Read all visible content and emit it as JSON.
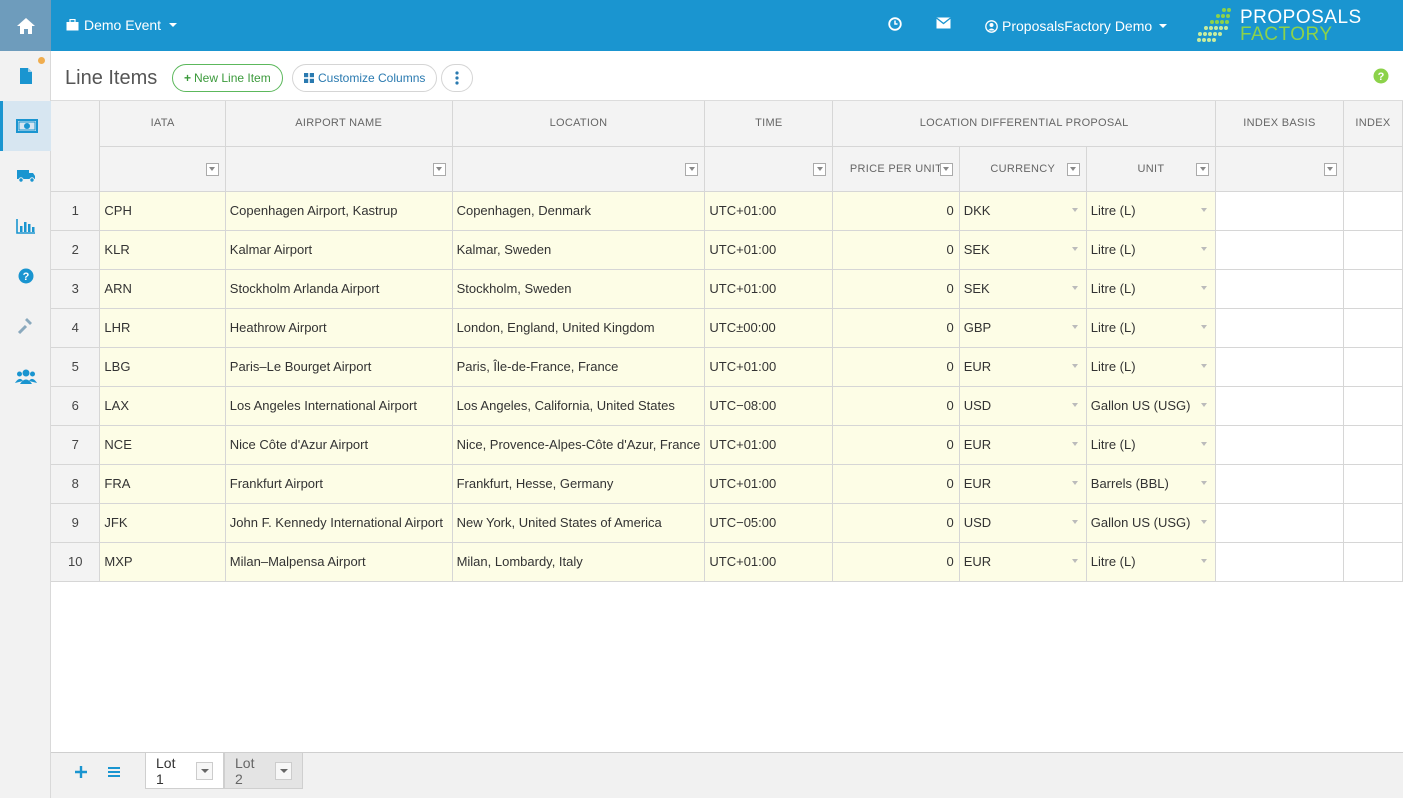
{
  "colors": {
    "accent": "#1a95d0",
    "logo_green": "#8cd24a",
    "row_highlight": "#fdfde6",
    "new_button": "#3c9a3c"
  },
  "rail": {
    "items": [
      {
        "icon": "document-icon",
        "active": false,
        "badge": true
      },
      {
        "icon": "money-icon",
        "active": true
      },
      {
        "icon": "truck-icon",
        "active": false
      },
      {
        "icon": "chart-icon",
        "active": false
      },
      {
        "icon": "question-icon",
        "active": false
      },
      {
        "icon": "wrench-icon",
        "active": false
      },
      {
        "icon": "users-icon",
        "active": false
      }
    ]
  },
  "topbar": {
    "event_label": "Demo Event",
    "user_label": "ProposalsFactory Demo",
    "logo_line1": "PROPOSALS",
    "logo_line2": "FACTORY"
  },
  "toolbar": {
    "title": "Line Items",
    "new_label": "New Line Item",
    "customize_label": "Customize Columns"
  },
  "grid": {
    "headers": {
      "iata": "IATA",
      "airport": "AIRPORT NAME",
      "location": "LOCATION",
      "time": "TIME",
      "group": "LOCATION DIFFERENTIAL PROPOSAL",
      "index_basis": "INDEX BASIS",
      "index": "INDEX"
    },
    "subheaders": {
      "price": "PRICE PER UNIT",
      "currency": "CURRENCY",
      "unit": "UNIT"
    },
    "rows": [
      {
        "n": "1",
        "iata": "CPH",
        "airport": "Copenhagen Airport, Kastrup",
        "location": "Copenhagen, Denmark",
        "time": "UTC+01:00",
        "price": "0",
        "currency": "DKK",
        "unit": "Litre (L)"
      },
      {
        "n": "2",
        "iata": "KLR",
        "airport": "Kalmar Airport",
        "location": "Kalmar, Sweden",
        "time": "UTC+01:00",
        "price": "0",
        "currency": "SEK",
        "unit": "Litre (L)"
      },
      {
        "n": "3",
        "iata": "ARN",
        "airport": "Stockholm Arlanda Airport",
        "location": "Stockholm, Sweden",
        "time": "UTC+01:00",
        "price": "0",
        "currency": "SEK",
        "unit": "Litre (L)"
      },
      {
        "n": "4",
        "iata": "LHR",
        "airport": "Heathrow Airport",
        "location": "London, England, United Kingdom",
        "time": "UTC±00:00",
        "price": "0",
        "currency": "GBP",
        "unit": "Litre (L)"
      },
      {
        "n": "5",
        "iata": "LBG",
        "airport": "Paris–Le Bourget Airport",
        "location": "Paris, Île-de-France, France",
        "time": "UTC+01:00",
        "price": "0",
        "currency": "EUR",
        "unit": "Litre (L)"
      },
      {
        "n": "6",
        "iata": "LAX",
        "airport": "Los Angeles International Airport",
        "location": "Los Angeles, California, United States",
        "time": "UTC−08:00",
        "price": "0",
        "currency": "USD",
        "unit": "Gallon US (USG)"
      },
      {
        "n": "7",
        "iata": "NCE",
        "airport": "Nice Côte d'Azur Airport",
        "location": "Nice, Provence-Alpes-Côte d'Azur, France",
        "time": "UTC+01:00",
        "price": "0",
        "currency": "EUR",
        "unit": "Litre (L)"
      },
      {
        "n": "8",
        "iata": "FRA",
        "airport": "Frankfurt Airport",
        "location": "Frankfurt, Hesse, Germany",
        "time": "UTC+01:00",
        "price": "0",
        "currency": "EUR",
        "unit": "Barrels (BBL)"
      },
      {
        "n": "9",
        "iata": "JFK",
        "airport": "John F. Kennedy International Airport",
        "location": "New York, United States of America",
        "time": "UTC−05:00",
        "price": "0",
        "currency": "USD",
        "unit": "Gallon US (USG)"
      },
      {
        "n": "10",
        "iata": "MXP",
        "airport": "Milan–Malpensa Airport",
        "location": "Milan, Lombardy, Italy",
        "time": "UTC+01:00",
        "price": "0",
        "currency": "EUR",
        "unit": "Litre (L)"
      }
    ]
  },
  "tabs": [
    {
      "label": "Lot 1",
      "active": true
    },
    {
      "label": "Lot 2",
      "active": false
    }
  ]
}
